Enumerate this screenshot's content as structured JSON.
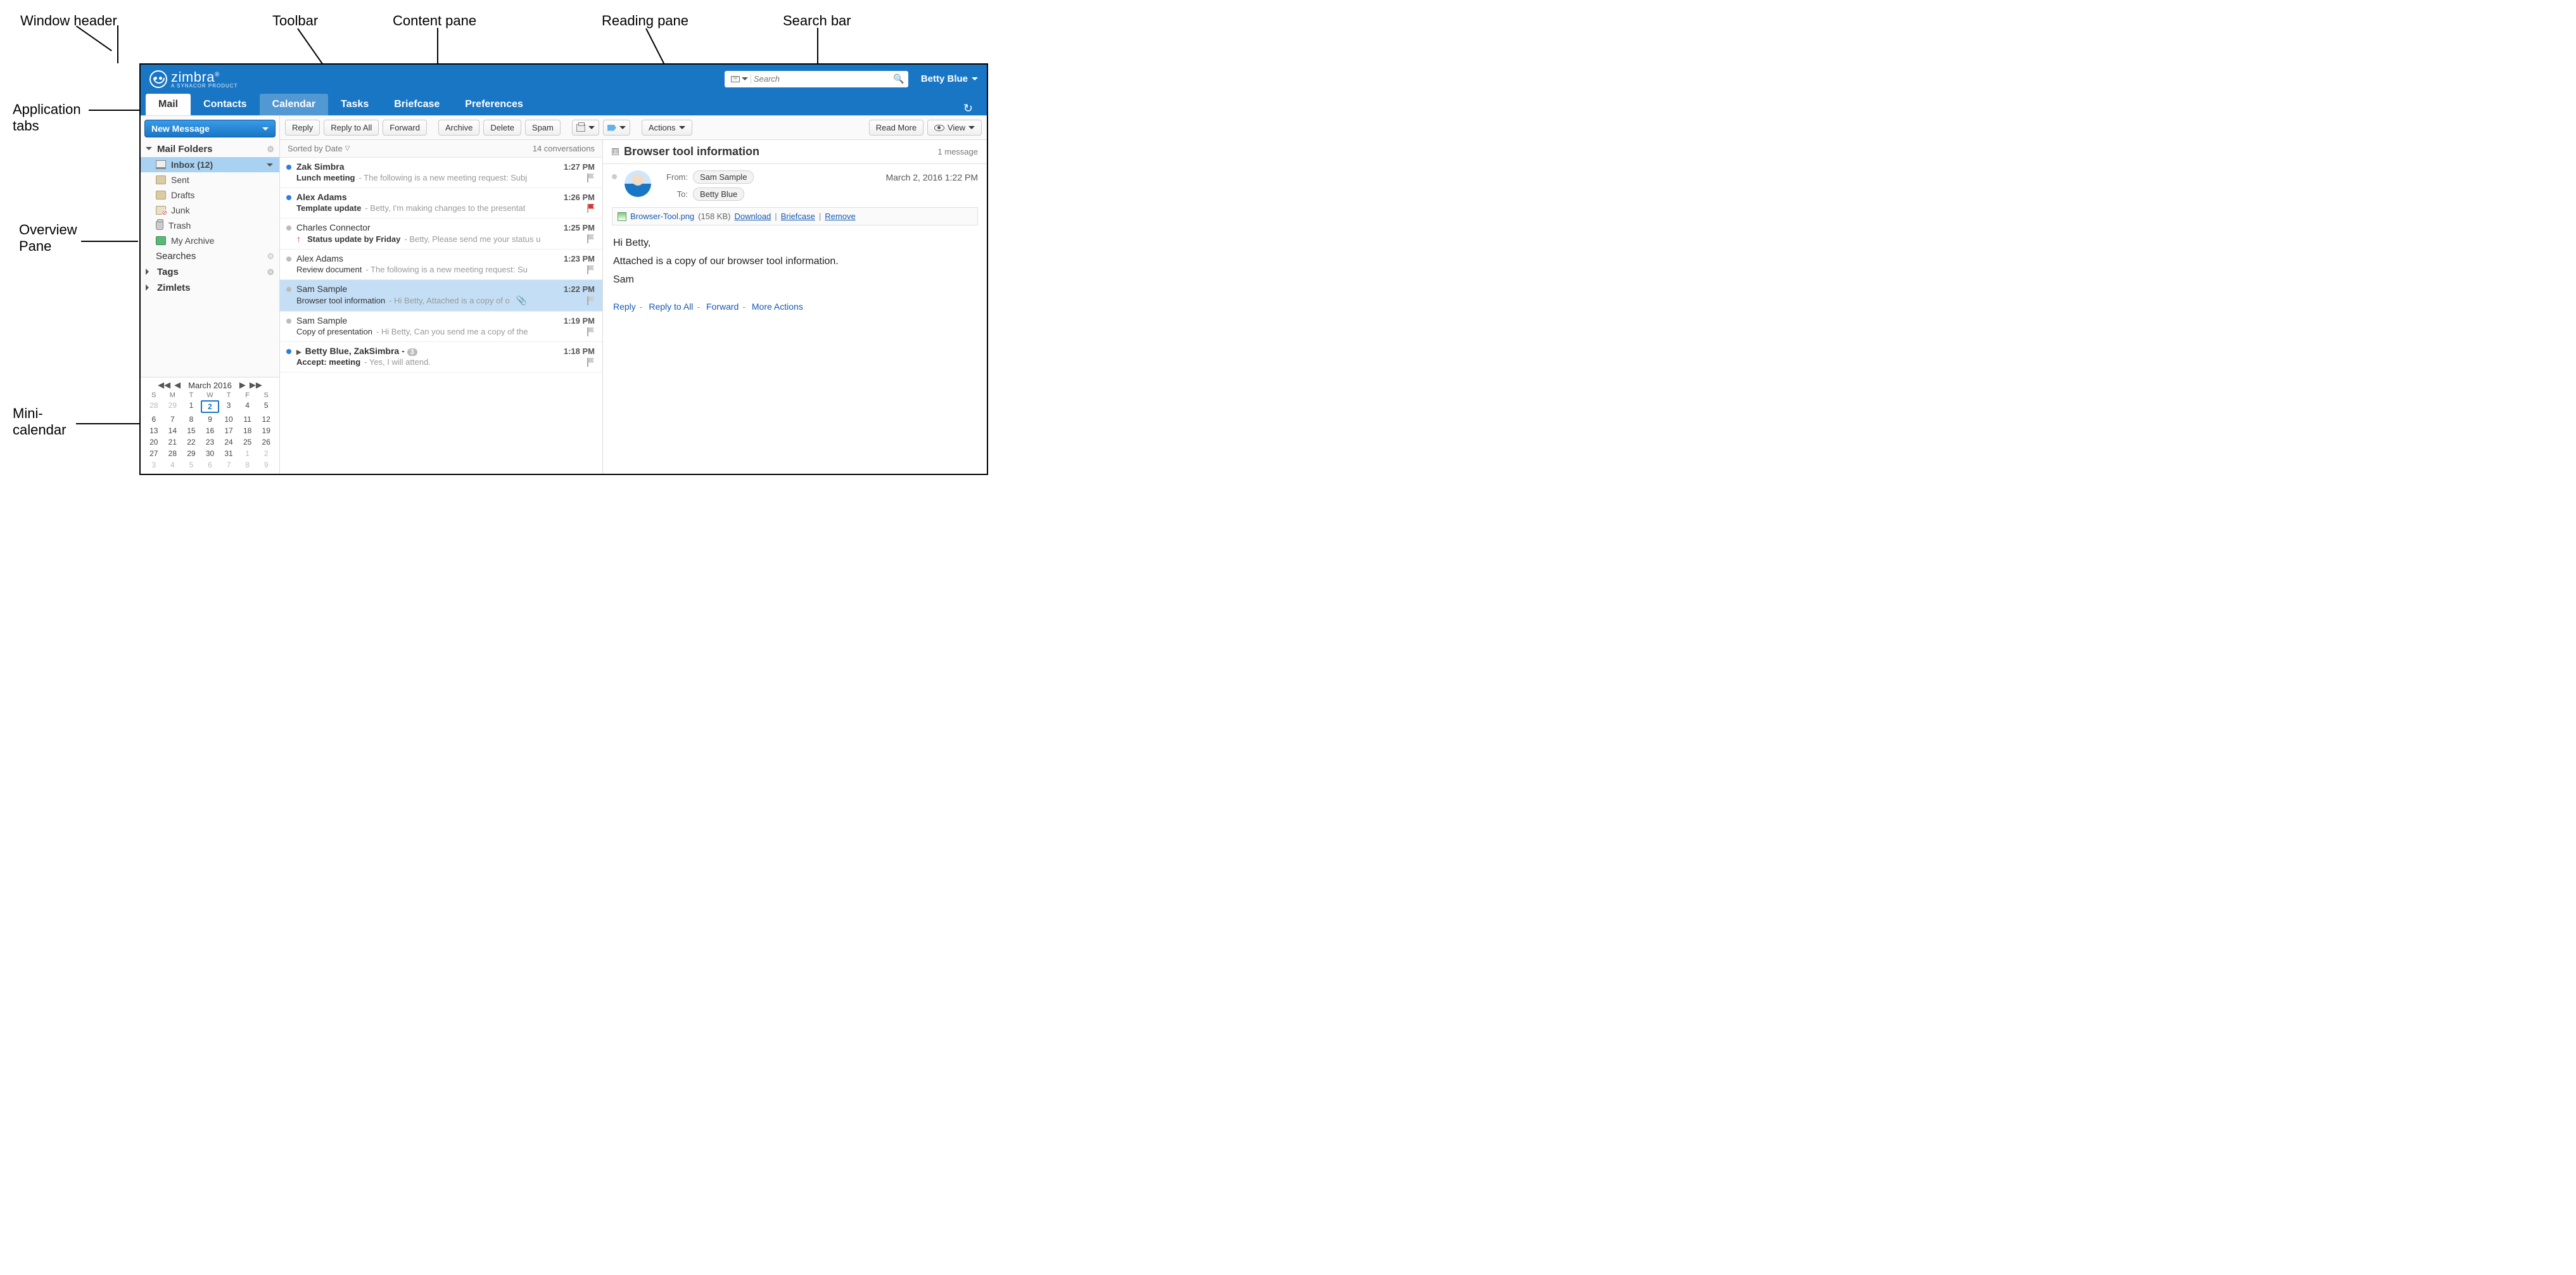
{
  "callouts": {
    "window_header": "Window header",
    "toolbar": "Toolbar",
    "content_pane": "Content pane",
    "reading_pane": "Reading pane",
    "search_bar": "Search bar",
    "application_tabs": "Application\ntabs",
    "overview_pane": "Overview\nPane",
    "mini_calendar": "Mini-\ncalendar"
  },
  "header": {
    "logo_text": "zimbra",
    "logo_sub": "A SYNACOR PRODUCT",
    "search_placeholder": "Search",
    "user_name": "Betty Blue"
  },
  "tabs": [
    "Mail",
    "Contacts",
    "Calendar",
    "Tasks",
    "Briefcase",
    "Preferences"
  ],
  "sidebar": {
    "new_message": "New Message",
    "folders_head": "Mail Folders",
    "folders": [
      {
        "label": "Inbox (12)",
        "icon": "inbox",
        "selected": true,
        "dropdown": true
      },
      {
        "label": "Sent",
        "icon": "folder"
      },
      {
        "label": "Drafts",
        "icon": "folder"
      },
      {
        "label": "Junk",
        "icon": "junk"
      },
      {
        "label": "Trash",
        "icon": "trash"
      },
      {
        "label": "My Archive",
        "icon": "archive"
      }
    ],
    "searches_head": "Searches",
    "tags_head": "Tags",
    "zimlets_head": "Zimlets"
  },
  "calendar": {
    "title": "March 2016",
    "dow": [
      "S",
      "M",
      "T",
      "W",
      "T",
      "F",
      "S"
    ],
    "days": [
      {
        "n": 28,
        "o": true
      },
      {
        "n": 29,
        "o": true
      },
      {
        "n": 1
      },
      {
        "n": 2,
        "today": true
      },
      {
        "n": 3
      },
      {
        "n": 4
      },
      {
        "n": 5
      },
      {
        "n": 6
      },
      {
        "n": 7
      },
      {
        "n": 8
      },
      {
        "n": 9
      },
      {
        "n": 10
      },
      {
        "n": 11
      },
      {
        "n": 12
      },
      {
        "n": 13
      },
      {
        "n": 14
      },
      {
        "n": 15
      },
      {
        "n": 16
      },
      {
        "n": 17
      },
      {
        "n": 18
      },
      {
        "n": 19
      },
      {
        "n": 20
      },
      {
        "n": 21
      },
      {
        "n": 22
      },
      {
        "n": 23
      },
      {
        "n": 24
      },
      {
        "n": 25
      },
      {
        "n": 26
      },
      {
        "n": 27
      },
      {
        "n": 28
      },
      {
        "n": 29
      },
      {
        "n": 30
      },
      {
        "n": 31
      },
      {
        "n": 1,
        "o": true
      },
      {
        "n": 2,
        "o": true
      },
      {
        "n": 3,
        "o": true
      },
      {
        "n": 4,
        "o": true
      },
      {
        "n": 5,
        "o": true
      },
      {
        "n": 6,
        "o": true
      },
      {
        "n": 7,
        "o": true
      },
      {
        "n": 8,
        "o": true
      },
      {
        "n": 9,
        "o": true
      }
    ]
  },
  "toolbar": {
    "reply": "Reply",
    "reply_all": "Reply to All",
    "forward": "Forward",
    "archive": "Archive",
    "delete": "Delete",
    "spam": "Spam",
    "actions": "Actions",
    "read_more": "Read More",
    "view": "View"
  },
  "list": {
    "sorted_by": "Sorted by Date",
    "count_text": "14 conversations",
    "items": [
      {
        "sender": "Zak Simbra",
        "time": "1:27 PM",
        "subject": "Lunch meeting",
        "preview": " - The following is a new meeting request: Subj",
        "unread": true,
        "flag": "gray"
      },
      {
        "sender": "Alex Adams",
        "time": "1:26 PM",
        "subject": "Template update",
        "preview": " - Betty, I'm making changes to the presentat",
        "unread": true,
        "flag": "red"
      },
      {
        "sender": "Charles Connector",
        "time": "1:25 PM",
        "subject": "Status update by Friday",
        "preview": " - Betty, Please send me your status u",
        "unread": false,
        "priority": "high",
        "flag": "gray",
        "subject_bold": true
      },
      {
        "sender": "Alex Adams",
        "time": "1:23 PM",
        "subject": "Review document",
        "preview": " - The following is a new meeting request: Su",
        "unread": false,
        "flag": "gray"
      },
      {
        "sender": "Sam Sample",
        "time": "1:22 PM",
        "subject": "Browser tool information",
        "preview": " - Hi Betty, Attached is a copy of o",
        "unread": false,
        "selected": true,
        "attach": true,
        "flag": "gray"
      },
      {
        "sender": "Sam Sample",
        "time": "1:19 PM",
        "subject": "Copy of presentation",
        "preview": " - Hi Betty, Can you send me a copy of the",
        "unread": false,
        "flag": "gray"
      },
      {
        "sender": "Betty Blue, ZakSimbra",
        "time": "1:18 PM",
        "subject": "Accept: meeting",
        "preview": " - Yes, I will attend.",
        "unread": true,
        "thread": true,
        "count": "3",
        "sender_suffix": " - ",
        "flag": "gray"
      }
    ]
  },
  "reading": {
    "subject": "Browser tool information",
    "count": "1 message",
    "from_label": "From:",
    "from_value": "Sam Sample",
    "to_label": "To:",
    "to_value": "Betty Blue",
    "date": "March 2, 2016 1:22 PM",
    "attachment_name": "Browser-Tool.png",
    "attachment_size": "(158 KB)",
    "download": "Download",
    "briefcase": "Briefcase",
    "remove": "Remove",
    "body_line1": "Hi Betty,",
    "body_line2": "Attached is a copy of our browser tool information.",
    "body_line3": "Sam",
    "act_reply": "Reply",
    "act_reply_all": "Reply to All",
    "act_forward": "Forward",
    "act_more": "More Actions"
  }
}
